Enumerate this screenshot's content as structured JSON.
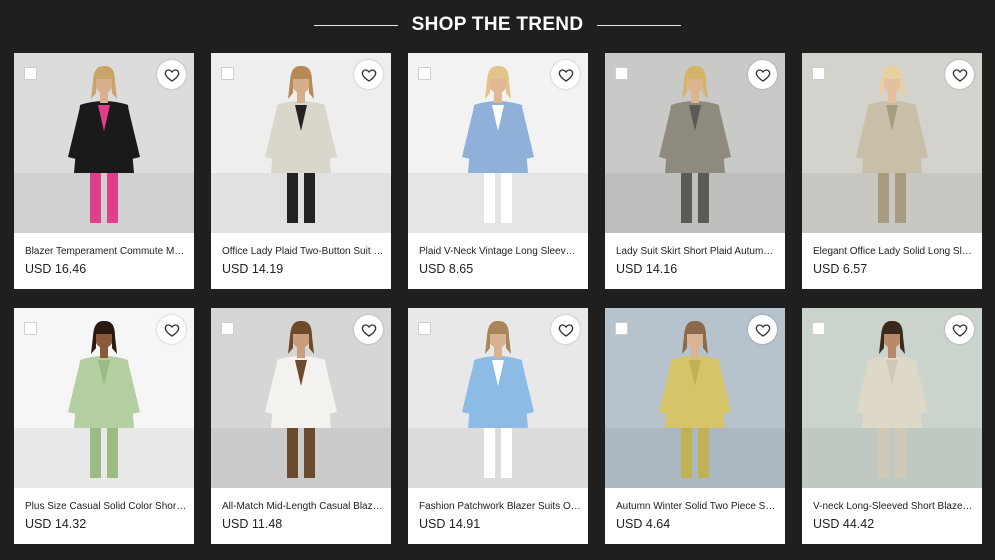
{
  "section": {
    "title": "SHOP THE TREND"
  },
  "products": [
    {
      "title": "Blazer Temperament Commute Me...",
      "price": "USD 16.46",
      "bg": "#dcdcdc",
      "garment": "#1a1a1a",
      "accent": "#e0408a",
      "skin": "#d8b08c",
      "hair": "#c9a46a"
    },
    {
      "title": "Office Lady Plaid Two-Button Suit B...",
      "price": "USD 14.19",
      "bg": "#eeeeee",
      "garment": "#d9d6cc",
      "accent": "#222222",
      "skin": "#d6ae8a",
      "hair": "#b58a55"
    },
    {
      "title": "Plaid V-Neck Vintage Long Sleeve ...",
      "price": "USD 8.65",
      "bg": "#f2f2f2",
      "garment": "#8fb0d8",
      "accent": "#ffffff",
      "skin": "#e0b896",
      "hair": "#e2c48a"
    },
    {
      "title": "Lady Suit Skirt Short Plaid Autumn ...",
      "price": "USD 14.16",
      "bg": "#c9c9c7",
      "garment": "#8e8a7e",
      "accent": "#5c5a54",
      "skin": "#dcb590",
      "hair": "#d6b36a"
    },
    {
      "title": "Elegant Office Lady Solid Long Slee...",
      "price": "USD 6.57",
      "bg": "#d4d2cc",
      "garment": "#c8bfa8",
      "accent": "#a89c80",
      "skin": "#e2c0a0",
      "hair": "#e6cfa0"
    },
    {
      "title": "Plus Size Casual Solid Color Short T...",
      "price": "USD 14.32",
      "bg": "#f6f6f6",
      "garment": "#b4cfa0",
      "accent": "#9cbc86",
      "skin": "#8a5a3a",
      "hair": "#2a1a12"
    },
    {
      "title": "All-Match Mid-Length Casual Blaze...",
      "price": "USD 11.48",
      "bg": "#d6d6d6",
      "garment": "#f4f2ee",
      "accent": "#6b4a2e",
      "skin": "#c89e7c",
      "hair": "#6e4a2c"
    },
    {
      "title": "Fashion Patchwork Blazer Suits Offi...",
      "price": "USD 14.91",
      "bg": "#e8e8e8",
      "garment": "#8cbce6",
      "accent": "#ffffff",
      "skin": "#d8b290",
      "hair": "#a8865a"
    },
    {
      "title": "Autumn Winter Solid Two Piece Set...",
      "price": "USD 4.64",
      "bg": "#b6c2cc",
      "garment": "#d6c468",
      "accent": "#c2b054",
      "skin": "#d8b494",
      "hair": "#8a6a4a"
    },
    {
      "title": "V-neck Long-Sleeved Short Blazer ...",
      "price": "USD 44.42",
      "bg": "#cbd4cc",
      "garment": "#ddd8c8",
      "accent": "#cfc9b6",
      "skin": "#b88a6a",
      "hair": "#3a2a1e"
    }
  ]
}
